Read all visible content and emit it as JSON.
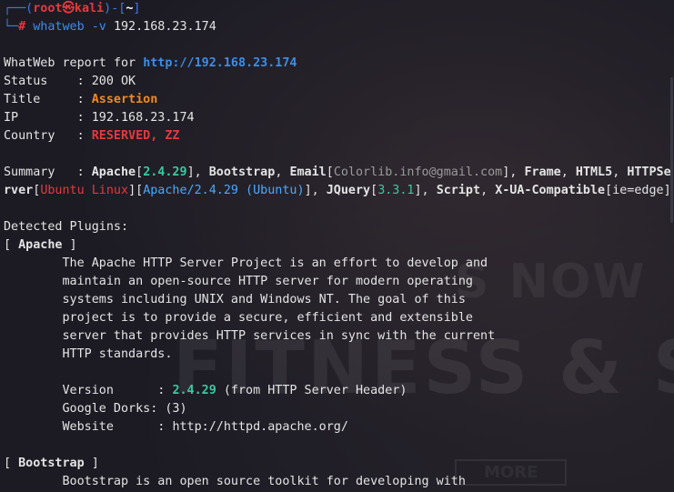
{
  "prompt": {
    "top_left": "┌──(",
    "user": "root",
    "skull": "㉿",
    "host": "kali",
    "mid": ")-[",
    "dir": "~",
    "close": "]",
    "bottom_left": "└─",
    "hash": "#",
    "cmd": "whatweb",
    "flag": "-v",
    "target": "192.168.23.174"
  },
  "report": {
    "header_label": "WhatWeb report for",
    "url": "http://192.168.23.174",
    "rows": [
      {
        "key": "Status    :",
        "value": "200 OK"
      },
      {
        "key": "Title     :",
        "value": "Assertion"
      },
      {
        "key": "IP        :",
        "value": "192.168.23.174"
      },
      {
        "key": "Country   :",
        "value": "RESERVED, ZZ"
      }
    ],
    "summary_label": "Summary   :",
    "summary": {
      "apache": "Apache",
      "apache_ver": "2.4.29",
      "bootstrap": "Bootstrap",
      "email": "Email",
      "email_val": "Colorlib.info@gmail.com",
      "frame": "Frame",
      "html5": "HTML5",
      "https_a": "HTTPSe",
      "https_b": "rver",
      "ubuntu": "Ubuntu Linux",
      "apache_full": "Apache/2.4.29 (Ubuntu)",
      "jquery": "JQuery",
      "jquery_ver": "3.3.1",
      "script": "Script",
      "xua": "X-UA-Compatible",
      "xua_val": "ie=edge"
    }
  },
  "plugins": {
    "heading": "Detected Plugins:",
    "apache": {
      "name": "Apache",
      "desc": [
        "The Apache HTTP Server Project is an effort to develop and",
        "maintain an open-source HTTP server for modern operating",
        "systems including UNIX and Windows NT. The goal of this",
        "project is to provide a secure, efficient and extensible",
        "server that provides HTTP services in sync with the current",
        "HTTP standards."
      ],
      "version_label": "Version      :",
      "version": "2.4.29",
      "version_note": "(from HTTP Server Header)",
      "dorks": "Google Dorks: (3)",
      "website_label": "Website      :",
      "website": "http://httpd.apache.org/"
    },
    "bootstrap": {
      "name": "Bootstrap",
      "desc": "Bootstrap is an open source toolkit for developing with"
    }
  },
  "watermark": {
    "line1": "S NOW",
    "line2": "FITNESS & SPO",
    "line3": "MORE"
  },
  "colors": {
    "background": "#1c1b24",
    "prompt_blue": "#3b7be0",
    "root_red": "#e5393d",
    "url_blue": "#3b8eea",
    "title_orange": "#f08a24",
    "version_green": "#39c9a0"
  }
}
